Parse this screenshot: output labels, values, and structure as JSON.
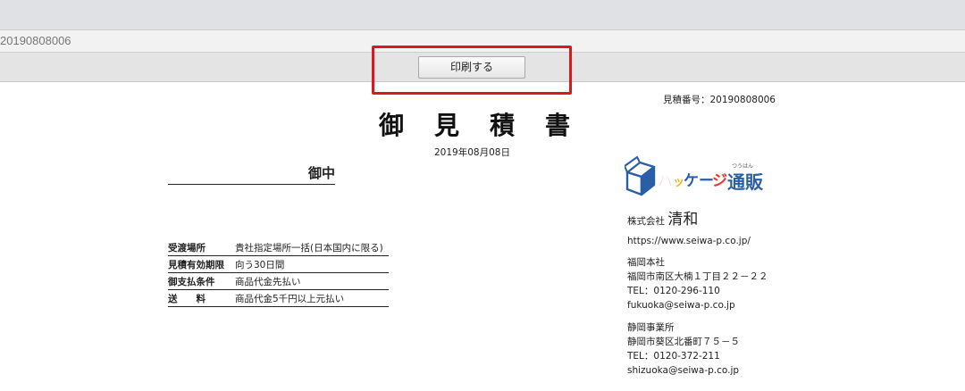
{
  "browser": {
    "address_text": "20190808006"
  },
  "toolbar": {
    "print_label": "印刷する"
  },
  "document": {
    "estimate_number": "見積番号：20190808006",
    "title_chars": [
      "御",
      "見",
      "積",
      "書"
    ],
    "date": "2019年08月08日",
    "recipient_suffix": "御中",
    "terms": [
      {
        "label": "受渡場所",
        "value": "貴社指定場所一括(日本国内に限る)"
      },
      {
        "label": "見積有効期限",
        "value": "向う30日間"
      },
      {
        "label": "御支払条件",
        "value": "商品代金先払い"
      },
      {
        "label": "送　　料",
        "value": "商品代金5千円以上元払い"
      }
    ]
  },
  "company": {
    "logo_text": "パッケージ通販",
    "logo_ruby": "つうはん",
    "name_prefix": "株式会社",
    "name": "清和",
    "url": "https://www.seiwa-p.co.jp/",
    "offices": [
      {
        "name": "福岡本社",
        "address": "福岡市南区大楠１丁目２２－２２",
        "tel": "TEL：0120-296-110",
        "email": "fukuoka@seiwa-p.co.jp"
      },
      {
        "name": "静岡事業所",
        "address": "静岡市葵区北番町７５－５",
        "tel": "TEL：0120-372-211",
        "email": "shizuoka@seiwa-p.co.jp"
      }
    ]
  },
  "colors": {
    "highlight": "#e0161b",
    "logo_blue": "#2a5fa8",
    "logo_red": "#e8372c",
    "logo_yellow": "#f2b319"
  }
}
